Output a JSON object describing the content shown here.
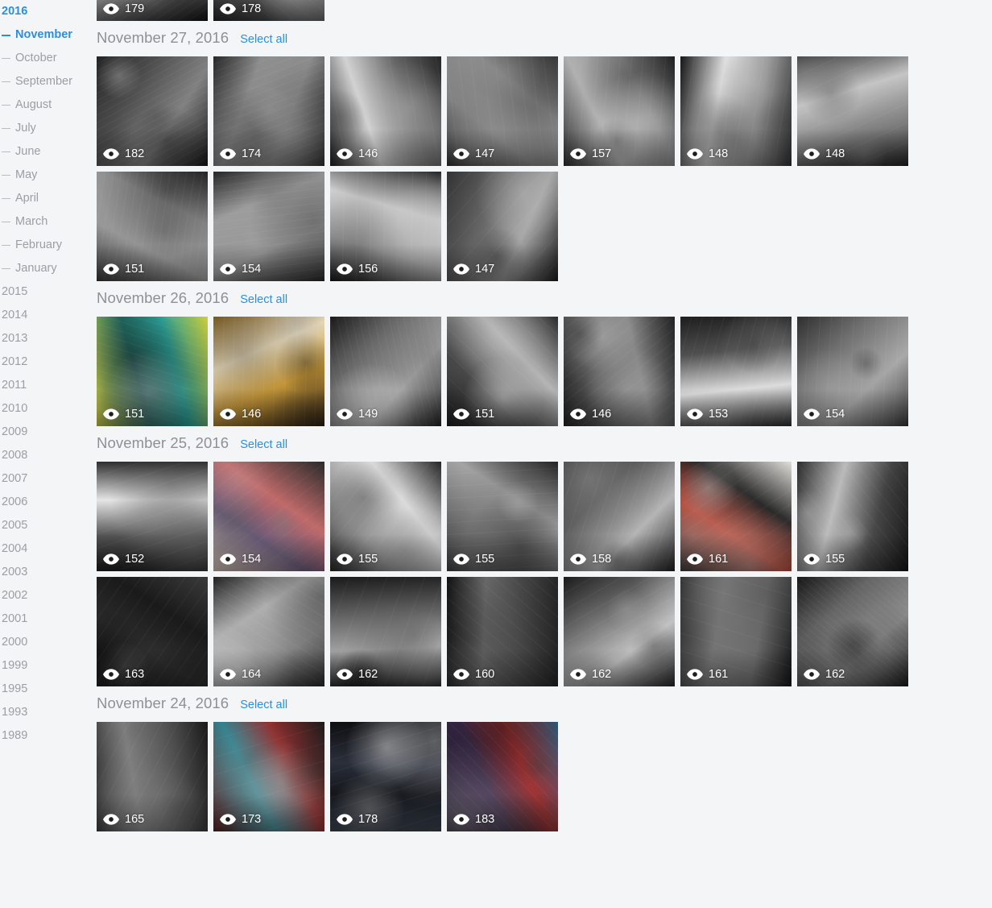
{
  "sidebar": {
    "current_year": "2016",
    "months": [
      {
        "label": "November",
        "active": true
      },
      {
        "label": "October",
        "active": false
      },
      {
        "label": "September",
        "active": false
      },
      {
        "label": "August",
        "active": false
      },
      {
        "label": "July",
        "active": false
      },
      {
        "label": "June",
        "active": false
      },
      {
        "label": "May",
        "active": false
      },
      {
        "label": "April",
        "active": false
      },
      {
        "label": "March",
        "active": false
      },
      {
        "label": "February",
        "active": false
      },
      {
        "label": "January",
        "active": false
      }
    ],
    "years": [
      "2015",
      "2014",
      "2013",
      "2012",
      "2011",
      "2010",
      "2009",
      "2008",
      "2007",
      "2006",
      "2005",
      "2004",
      "2003",
      "2002",
      "2001",
      "2000",
      "1999",
      "1995",
      "1993",
      "1989"
    ]
  },
  "icons": {
    "eye": "eye-icon",
    "dash": "dash-icon"
  },
  "colors": {
    "accent": "#2b8fe0",
    "background": "#f4f5f7",
    "muted_text": "#9b9ea3",
    "date_text": "#8c9196",
    "badge_text": "#ffffff"
  },
  "top_partial_row": {
    "photos": [
      {
        "views": "179",
        "tone": "dark-portrait"
      },
      {
        "views": "178",
        "tone": "light-hands"
      }
    ]
  },
  "groups": [
    {
      "date": "November 27, 2016",
      "select_all_label": "Select all",
      "photos": [
        {
          "views": "182",
          "tone": "corridor"
        },
        {
          "views": "174",
          "tone": "two-men"
        },
        {
          "views": "146",
          "tone": "office-shelf"
        },
        {
          "views": "147",
          "tone": "whiteboard"
        },
        {
          "views": "157",
          "tone": "laptop-man"
        },
        {
          "views": "148",
          "tone": "handwriting"
        },
        {
          "views": "148",
          "tone": "shop-door"
        },
        {
          "views": "151",
          "tone": "man-board"
        },
        {
          "views": "154",
          "tone": "desk-papers"
        },
        {
          "views": "156",
          "tone": "laptop-desk"
        },
        {
          "views": "147",
          "tone": "window-grid"
        }
      ]
    },
    {
      "date": "November 26, 2016",
      "select_all_label": "Select all",
      "photos": [
        {
          "views": "151",
          "tone": "jars-color"
        },
        {
          "views": "146",
          "tone": "club-mate"
        },
        {
          "views": "149",
          "tone": "cafe-work"
        },
        {
          "views": "151",
          "tone": "street-art"
        },
        {
          "views": "146",
          "tone": "two-walkers"
        },
        {
          "views": "153",
          "tone": "bridge-under"
        },
        {
          "views": "154",
          "tone": "sticker-wall"
        }
      ]
    },
    {
      "date": "November 25, 2016",
      "select_all_label": "Select all",
      "photos": [
        {
          "views": "152",
          "tone": "bar-talk"
        },
        {
          "views": "154",
          "tone": "two-smiling"
        },
        {
          "views": "155",
          "tone": "long-table"
        },
        {
          "views": "155",
          "tone": "cheers"
        },
        {
          "views": "158",
          "tone": "beer-two"
        },
        {
          "views": "161",
          "tone": "red-beanie"
        },
        {
          "views": "155",
          "tone": "night-profile"
        },
        {
          "views": "163",
          "tone": "foodora-wall"
        },
        {
          "views": "164",
          "tone": "crowd-dark"
        },
        {
          "views": "162",
          "tone": "sketch-paper"
        },
        {
          "views": "160",
          "tone": "can-table"
        },
        {
          "views": "162",
          "tone": "presenting"
        },
        {
          "views": "161",
          "tone": "standing-man"
        },
        {
          "views": "162",
          "tone": "loft-window"
        }
      ]
    },
    {
      "date": "November 24, 2016",
      "select_all_label": "Select all",
      "photos": [
        {
          "views": "165",
          "tone": "kitchen-cook"
        },
        {
          "views": "173",
          "tone": "graffiti-man"
        },
        {
          "views": "178",
          "tone": "night-street"
        },
        {
          "views": "183",
          "tone": "xmas-plaza"
        }
      ]
    }
  ]
}
